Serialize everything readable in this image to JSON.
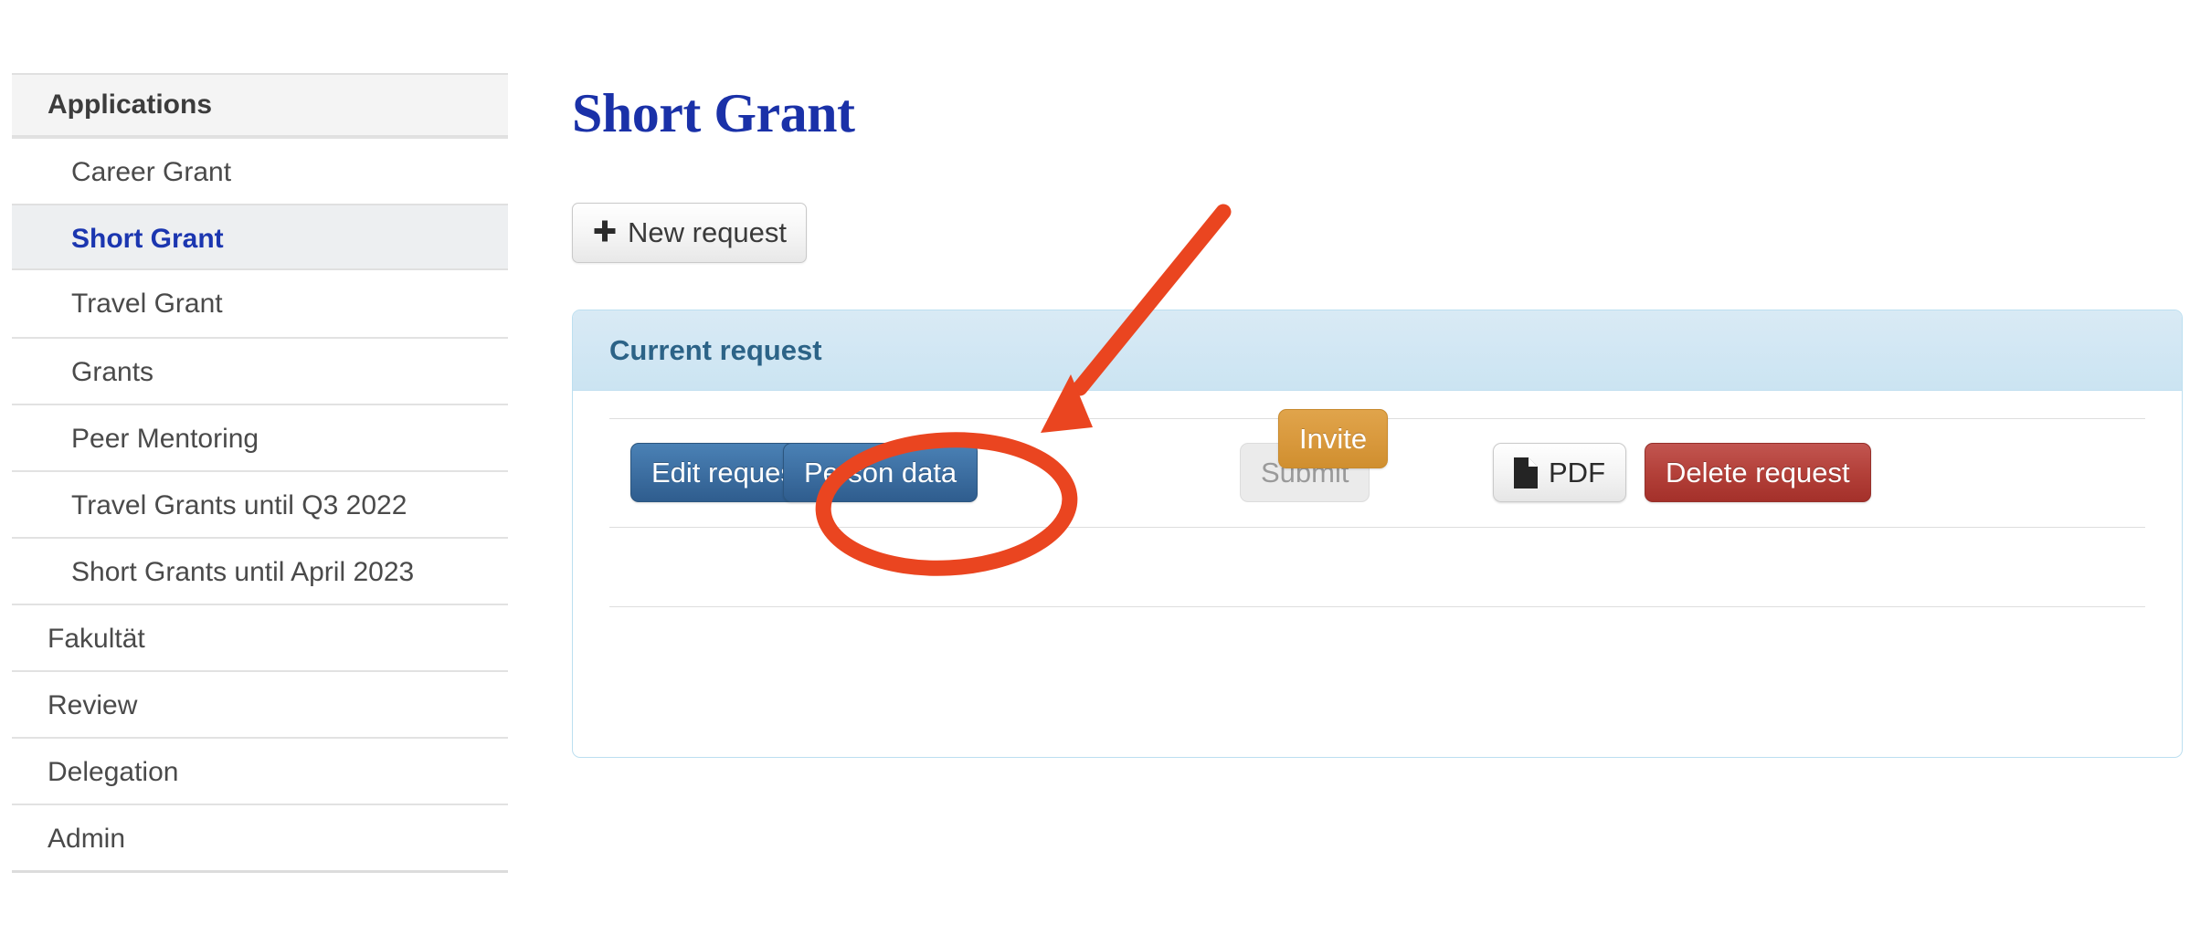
{
  "sidebar": {
    "items": [
      {
        "label": "Applications",
        "level": "header",
        "active": false
      },
      {
        "label": "Career Grant",
        "level": 2,
        "active": false
      },
      {
        "label": "Short Grant",
        "level": 2,
        "active": true
      },
      {
        "label": "Travel Grant",
        "level": 2,
        "active": false
      },
      {
        "label": "Grants",
        "level": 2,
        "active": false
      },
      {
        "label": "Peer Mentoring",
        "level": 2,
        "active": false
      },
      {
        "label": "Travel Grants until Q3 2022",
        "level": 2,
        "active": false
      },
      {
        "label": "Short Grants until April 2023",
        "level": 2,
        "active": false
      },
      {
        "label": "Fakultät",
        "level": 1,
        "active": false
      },
      {
        "label": "Review",
        "level": 1,
        "active": false
      },
      {
        "label": "Delegation",
        "level": 1,
        "active": false
      },
      {
        "label": "Admin",
        "level": 1,
        "active": false
      }
    ]
  },
  "main": {
    "page_title": "Short Grant",
    "new_request_label": "New request",
    "new_request_icon": "plus-icon",
    "plus_glyph": "✚"
  },
  "panel": {
    "header_title": "Current request",
    "buttons": {
      "edit_request": "Edit request",
      "person_data": "Person data",
      "submit": "Submit",
      "submit_disabled": true,
      "pdf": "PDF",
      "pdf_icon": "file-icon",
      "delete_request": "Delete request",
      "invite": "Invite"
    }
  },
  "annotations": {
    "circle": {
      "shape": "ellipse",
      "target": "person-data-button",
      "color": "#ea4520"
    },
    "arrow": {
      "shape": "arrow",
      "direction": "down-left",
      "color": "#ea4520"
    }
  },
  "colors": {
    "accent_blue": "#1a31a8",
    "panel_header_text": "#2c6387",
    "panel_header_bg": "#cfe5f2",
    "primary_button": "#3d6fa2",
    "danger_button": "#b34039",
    "warning_button": "#d9993d",
    "annotation_red": "#ea4520"
  }
}
